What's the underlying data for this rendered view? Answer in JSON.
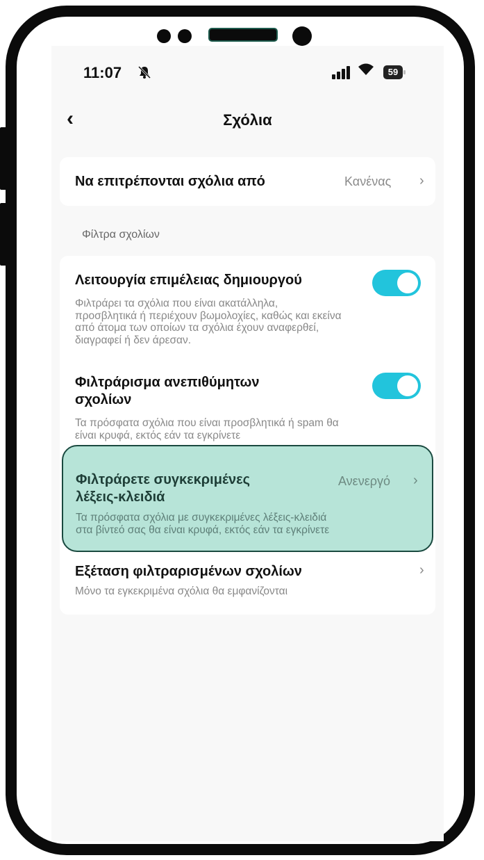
{
  "status": {
    "time": "11:07",
    "battery": "59"
  },
  "nav": {
    "title": "Σχόλια"
  },
  "allow_comments": {
    "label": "Να επιτρέπονται σχόλια από",
    "value": "Κανένας"
  },
  "section_title": "Φίλτρα σχολίων",
  "filters": [
    {
      "label": "Λειτουργία επιμέλειας δημιουργού",
      "desc_lines": [
        "Φιλτράρει τα σχόλια που είναι ακατάλληλα,",
        "προσβλητικά ή περιέχουν βωμολοχίες, καθώς και εκείνα",
        "από άτομα των οποίων τα σχόλια έχουν αναφερθεί,",
        "διαγραφεί ή δεν άρεσαν."
      ],
      "enabled": true
    },
    {
      "label_lines": [
        "Φιλτράρισμα ανεπιθύμητων",
        "σχολίων"
      ],
      "desc_lines": [
        "Τα πρόσφατα σχόλια που είναι προσβλητικά ή spam θα",
        "είναι κρυφά, εκτός εάν τα εγκρίνετε"
      ],
      "enabled": true
    },
    {
      "label_lines": [
        "Φιλτράρετε συγκεκριμένες",
        "λέξεις-κλειδιά"
      ],
      "value": "Ανενεργό",
      "desc_lines": [
        "Τα πρόσφατα σχόλια με συγκεκριμένες λέξεις-κλειδιά",
        "στα βίντεό σας θα είναι κρυφά, εκτός εάν τα εγκρίνετε"
      ]
    },
    {
      "label": "Εξέταση φιλτραρισμένων σχολίων",
      "desc": "Μόνο τα εγκεκριμένα σχόλια θα εμφανίζονται"
    }
  ],
  "colors": {
    "toggle_on": "#22c4dc",
    "highlight_bg": "#b7e4d8",
    "highlight_border": "#1a4a40"
  }
}
